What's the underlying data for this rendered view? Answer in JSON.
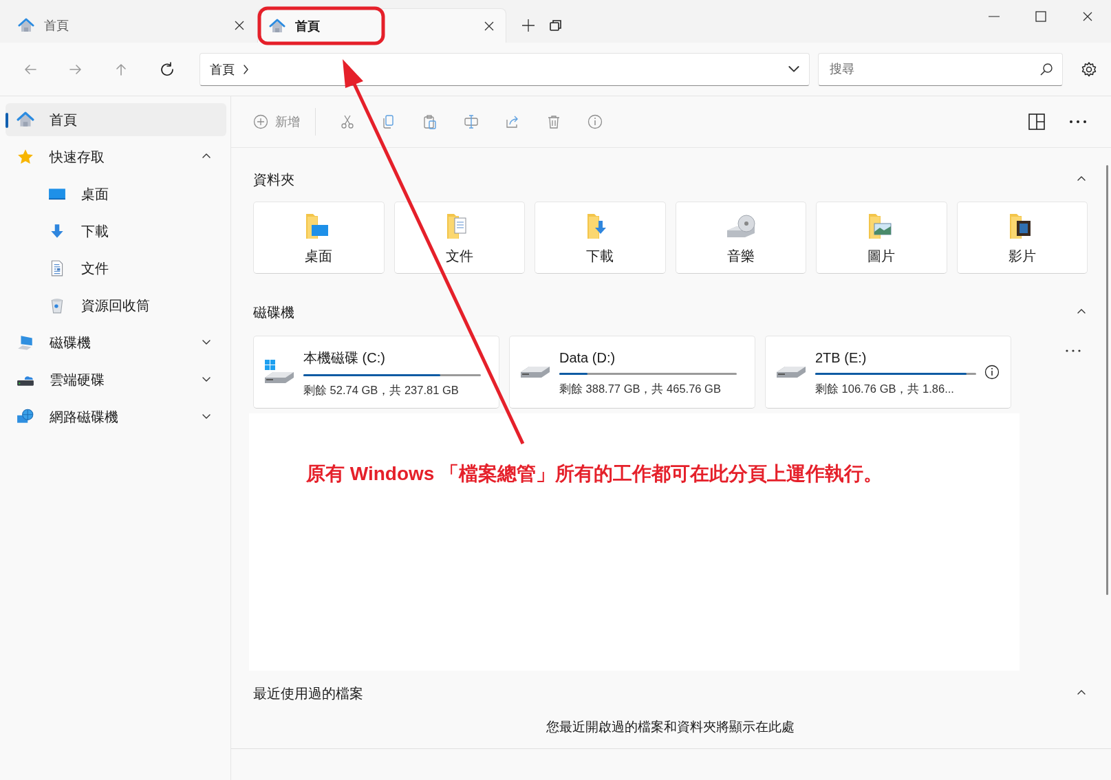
{
  "tabs": [
    {
      "label": "首頁",
      "selected": false
    },
    {
      "label": "首頁",
      "selected": true
    }
  ],
  "nav": [
    {
      "kind": "back",
      "disabled": true
    },
    {
      "kind": "forward",
      "disabled": true
    },
    {
      "kind": "up",
      "disabled": true
    },
    {
      "kind": "refresh",
      "disabled": false
    }
  ],
  "address": {
    "path": "首頁"
  },
  "search": {
    "placeholder": "搜尋"
  },
  "sidebar": {
    "items": [
      {
        "label": "首頁",
        "selected": true
      },
      {
        "label": "快速存取",
        "selected": false,
        "expanded": true,
        "children": [
          {
            "label": "桌面",
            "selected": false
          },
          {
            "label": "下載",
            "selected": false
          },
          {
            "label": "文件",
            "selected": false
          },
          {
            "label": "資源回收筒",
            "selected": false
          }
        ]
      },
      {
        "label": "磁碟機",
        "selected": false,
        "expanded": false
      },
      {
        "label": "雲端硬碟",
        "selected": false,
        "expanded": false
      },
      {
        "label": "網路磁碟機",
        "selected": false,
        "expanded": false
      }
    ]
  },
  "toolbar": {
    "new_label": "新增"
  },
  "sections": [
    {
      "kind": "folders",
      "title": "資料夾",
      "expanded": true,
      "items": [
        {
          "label": "桌面"
        },
        {
          "label": "文件"
        },
        {
          "label": "下載"
        },
        {
          "label": "音樂"
        },
        {
          "label": "圖片"
        },
        {
          "label": "影片"
        }
      ]
    },
    {
      "kind": "drives",
      "title": "磁碟機",
      "expanded": true,
      "items": [
        {
          "name": "本機磁碟 (C:)",
          "system": true,
          "level": 0.77,
          "free": "剩餘 52.74 GB，共 237.81 GB",
          "hovered": false
        },
        {
          "name": "Data (D:)",
          "system": false,
          "level": 0.16,
          "free": "剩餘 388.77 GB，共 465.76 GB",
          "hovered": false
        },
        {
          "name": "2TB (E:)",
          "system": false,
          "level": 0.94,
          "free": "剩餘 106.76 GB，共 1.86...",
          "hovered": true
        }
      ]
    },
    {
      "kind": "recent",
      "title": "最近使用過的檔案",
      "expanded": true,
      "empty_message": "您最近開啟過的檔案和資料夾將顯示在此處"
    }
  ],
  "annotation": {
    "text": "原有 Windows 「檔案總管」所有的工作都可在此分頁上運作執行。"
  }
}
